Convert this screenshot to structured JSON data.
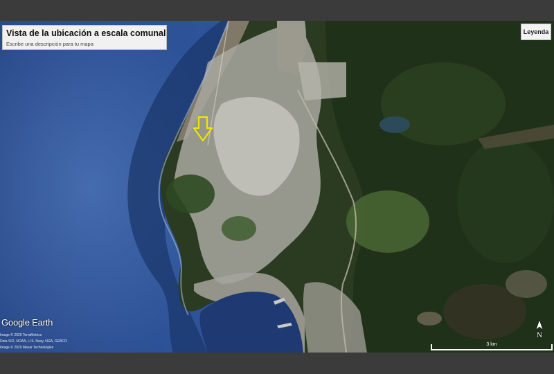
{
  "map_title": "Vista de la ubicación a escala comunal",
  "map_description": "Escribe una descripción para tu mapa",
  "legend_button": "Leyenda",
  "logo_text": "Google Earth",
  "credits": [
    "Image © 2020 TerraMetrics",
    "Data SIO, NOAA, U.S. Navy, NGA, GEBCO",
    "Image © 2020 Maxar Technologies"
  ],
  "north_label": "N",
  "scale_label": "3 km",
  "marker": {
    "type": "arrow",
    "color": "#f5e400"
  },
  "colors": {
    "ocean_deep": "#2a4a8a",
    "ocean_shallow": "#3d69b0",
    "land_forest": "#23361c",
    "urban": "#b9b9b3"
  }
}
